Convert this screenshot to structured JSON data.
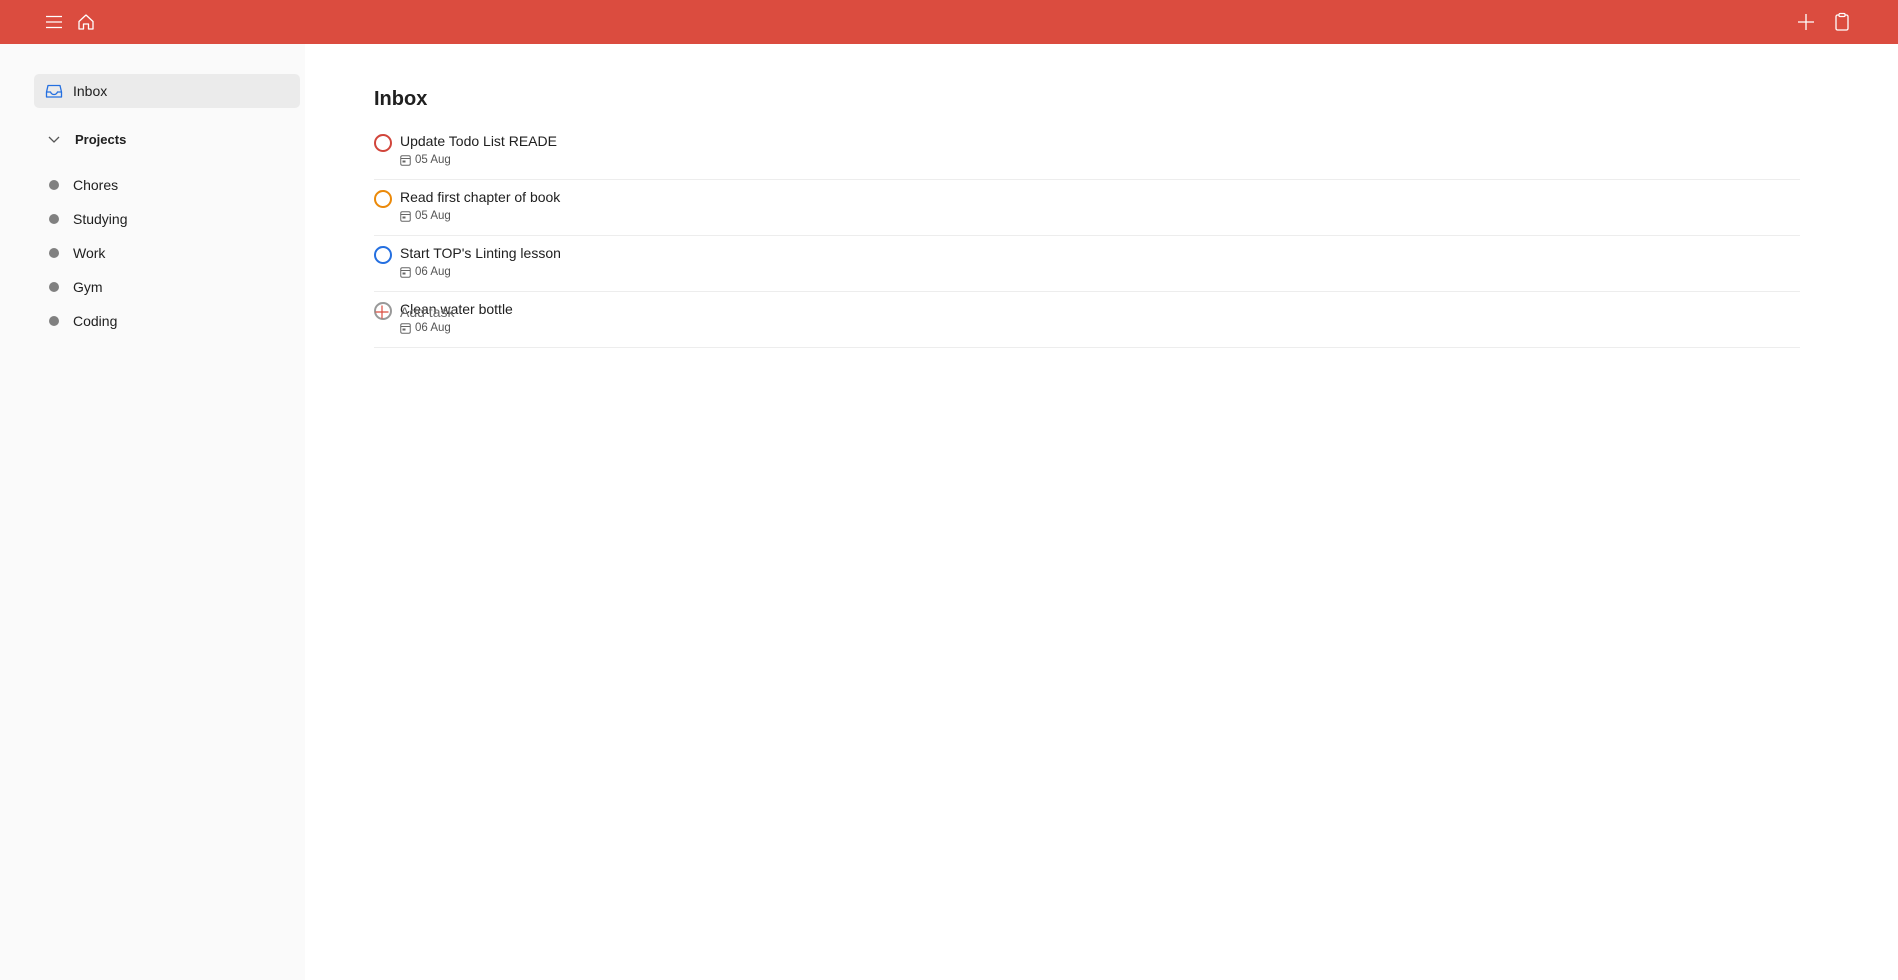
{
  "colors": {
    "topbar": "#db4c3f",
    "sidebar_bg": "#fafafa",
    "inbox_icon": "#246fe0",
    "add_task_plus": "#db4c3f"
  },
  "topbar": {
    "icons": [
      "menu-icon",
      "home-icon",
      "plus-icon",
      "clipboard-icon"
    ]
  },
  "sidebar": {
    "inbox_label": "Inbox",
    "projects_label": "Projects",
    "projects": [
      {
        "label": "Chores"
      },
      {
        "label": "Studying"
      },
      {
        "label": "Work"
      },
      {
        "label": "Gym"
      },
      {
        "label": "Coding"
      }
    ]
  },
  "main": {
    "title": "Inbox",
    "tasks": [
      {
        "title": "Update Todo List READE",
        "due": "05 Aug",
        "priority_color": "#d1453b"
      },
      {
        "title": "Read first chapter of book",
        "due": "05 Aug",
        "priority_color": "#eb8909"
      },
      {
        "title": "Start TOP's Linting lesson",
        "due": "06 Aug",
        "priority_color": "#246fe0"
      },
      {
        "title": "Clean water bottle",
        "due": "06 Aug",
        "priority_color": "#999999"
      }
    ],
    "add_task_label": "Add task"
  }
}
